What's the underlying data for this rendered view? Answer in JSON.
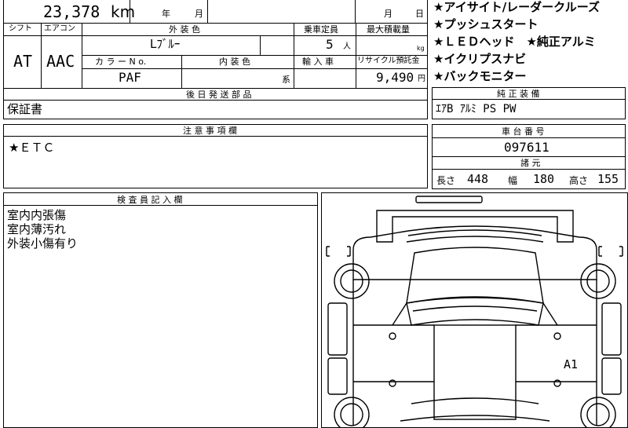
{
  "top": {
    "mileage_value": "23,378",
    "mileage_unit": "km",
    "year_label": "年",
    "month_label": "月",
    "month_label2": "月",
    "day_label": "日"
  },
  "spec_table": {
    "shift_header": "シフト",
    "aircon_header": "エアコン",
    "exterior_header": "外 装 色",
    "capacity_header": "乗車定員",
    "max_load_header": "最大積載量",
    "shift_value": "AT",
    "aircon_value": "AAC",
    "exterior_value": "Lﾌﾞﾙｰ",
    "capacity_value": "5",
    "capacity_unit": "人",
    "load_unit": "kg",
    "color_no_header": "カ ラ ー N o.",
    "interior_header": "内 装 色",
    "import_header": "輸 入 車",
    "recycle_header": "リサイクル預託金",
    "color_no_value": "PAF",
    "interior_unit": "系",
    "recycle_value": "9,490",
    "recycle_unit": "円"
  },
  "features": [
    "★アイサイト/レーダークルーズ",
    "★プッシュスタート",
    "★ＬＥＤヘッド　★純正アルミ",
    "★イクリプスナビ",
    "★バックモニター"
  ],
  "later_parts": {
    "header": "後 日 発 送 部 品",
    "value": "保証書"
  },
  "genuine_equipment": {
    "header": "純 正 装 備",
    "value": "ｴｱB ｱﾙﾐ PS PW"
  },
  "notes": {
    "header": "注 意 事 項 欄",
    "value": "★ＥＴＣ"
  },
  "chassis": {
    "header": "車 台 番 号",
    "value": "097611"
  },
  "dimensions": {
    "header": "諸 元",
    "length_label": "長さ",
    "length_value": "448",
    "width_label": "幅",
    "width_value": "180",
    "height_label": "高さ",
    "height_value": "155"
  },
  "inspector": {
    "header": "検 査 員 記 入 欄",
    "lines": [
      "室内内張傷",
      "室内薄汚れ",
      "外装小傷有り"
    ]
  },
  "diagram": {
    "marks": [
      "A1"
    ]
  }
}
